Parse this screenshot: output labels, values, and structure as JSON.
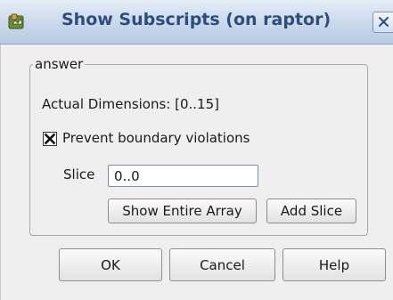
{
  "window": {
    "title": "Show Subscripts (on raptor)"
  },
  "group": {
    "label": "answer"
  },
  "dimensions": {
    "text": "Actual Dimensions: [0..15]"
  },
  "prevent_boundary": {
    "label": "Prevent boundary violations",
    "checked": true
  },
  "slice": {
    "label": "Slice",
    "value": "0..0"
  },
  "buttons": {
    "show_entire_array": "Show Entire Array",
    "add_slice": "Add Slice",
    "ok": "OK",
    "cancel": "Cancel",
    "help": "Help"
  },
  "colors": {
    "title_text": "#2d4e7d",
    "titlebar": "#c9d8ea",
    "dialog_bg": "#efefef"
  }
}
